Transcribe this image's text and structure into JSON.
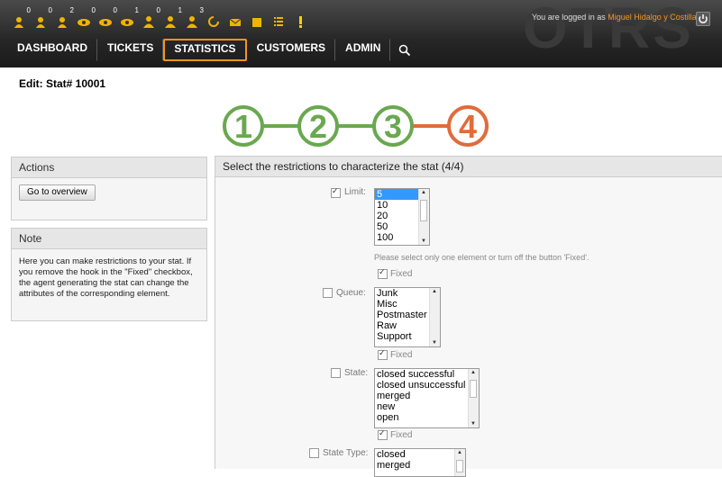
{
  "header": {
    "logo": "OTRS",
    "toolbar": [
      {
        "icon": "locked-new-tickets-icon",
        "count": "0"
      },
      {
        "icon": "locked-reminder-tickets-icon",
        "count": "0"
      },
      {
        "icon": "locked-all-tickets-icon",
        "count": "2"
      },
      {
        "icon": "watched-new-tickets-icon",
        "count": "0"
      },
      {
        "icon": "watched-reminder-tickets-icon",
        "count": "0"
      },
      {
        "icon": "watched-all-tickets-icon",
        "count": "1"
      },
      {
        "icon": "responsible-new-tickets-icon",
        "count": "0"
      },
      {
        "icon": "responsible-reminder-tickets-icon",
        "count": "1"
      },
      {
        "icon": "responsible-all-tickets-icon",
        "count": "3"
      },
      {
        "icon": "refresh-icon",
        "count": ""
      },
      {
        "icon": "email-icon",
        "count": ""
      },
      {
        "icon": "phone-icon",
        "count": ""
      },
      {
        "icon": "list-icon",
        "count": ""
      },
      {
        "icon": "alert-icon",
        "count": ""
      }
    ],
    "logged_prefix": "You are logged in as",
    "user_name": "Miguel Hidalgo y Costilla",
    "nav": [
      {
        "label": "DASHBOARD",
        "active": false
      },
      {
        "label": "TICKETS",
        "active": false
      },
      {
        "label": "STATISTICS",
        "active": true
      },
      {
        "label": "CUSTOMERS",
        "active": false
      },
      {
        "label": "ADMIN",
        "active": false
      }
    ]
  },
  "page": {
    "title": "Edit: Stat# 10001",
    "steps": [
      {
        "label": "1",
        "color": "#6aa84f"
      },
      {
        "label": "2",
        "color": "#6aa84f"
      },
      {
        "label": "3",
        "color": "#6aa84f"
      },
      {
        "label": "4",
        "color": "#e06c3c"
      }
    ]
  },
  "actions": {
    "title": "Actions",
    "overview_button": "Go to overview"
  },
  "note": {
    "title": "Note",
    "text": "Here you can make restrictions to your stat. If you remove the hook in the \"Fixed\" checkbox, the agent generating the stat can change the attributes of the corresponding element."
  },
  "main": {
    "title": "Select the restrictions to characterize the stat (4/4)",
    "fixed_label": "Fixed",
    "limit": {
      "label": "Limit:",
      "checked": true,
      "options": [
        "5",
        "10",
        "20",
        "50",
        "100"
      ],
      "selected": "5",
      "hint": "Please select only one element or turn off the button 'Fixed'.",
      "fixed": true
    },
    "queue": {
      "label": "Queue:",
      "checked": false,
      "options": [
        "Junk",
        "Misc",
        "Postmaster",
        "Raw",
        "Support"
      ],
      "fixed": true
    },
    "state": {
      "label": "State:",
      "checked": false,
      "options": [
        "closed successful",
        "closed unsuccessful",
        "merged",
        "new",
        "open"
      ],
      "fixed": true
    },
    "state_type": {
      "label": "State Type:",
      "checked": false,
      "options": [
        "closed",
        "merged"
      ]
    }
  }
}
